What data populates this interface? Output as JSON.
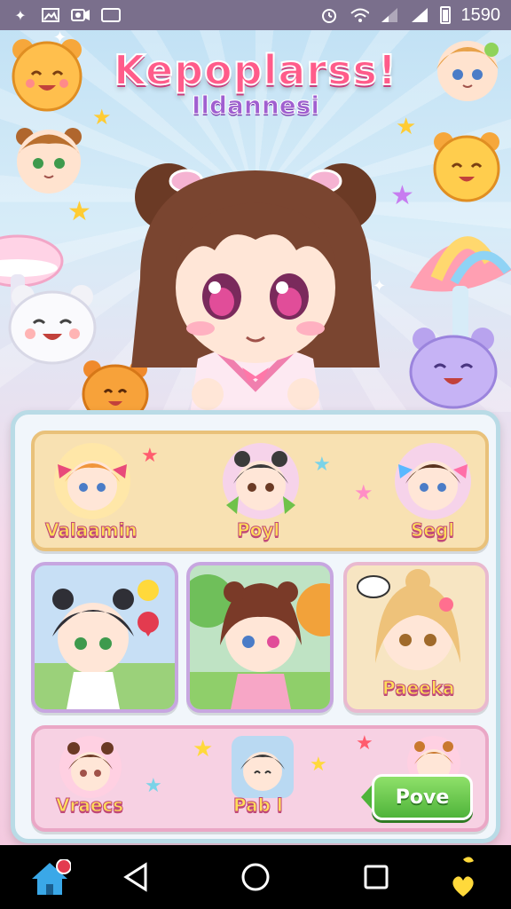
{
  "status_bar": {
    "time": "1590",
    "icons": [
      "pinwheel-icon",
      "image-icon",
      "camera-icon",
      "box-icon",
      "alarm-icon",
      "wifi-icon",
      "signal-icon",
      "signal-icon",
      "battery-icon"
    ]
  },
  "hero": {
    "title": "Kepoplarss!",
    "subtitle": "Ildannesi"
  },
  "panel": {
    "row1": [
      {
        "name": "Valaamin",
        "ribbon": "#ff6f9f"
      },
      {
        "name": "Poyl",
        "ribbon": "#ff6f9f"
      },
      {
        "name": "Segl",
        "ribbon": "#6fc3ff"
      }
    ],
    "row2": [
      {
        "name": ""
      },
      {
        "name": ""
      },
      {
        "name": "Paeeka"
      }
    ],
    "row3": [
      {
        "name": "Vraecs"
      },
      {
        "name": "Pab l"
      }
    ],
    "action_button": "Pove"
  },
  "nav": {
    "items": [
      "home-icon",
      "back-icon",
      "home-circle-icon",
      "recents-icon",
      "assistant-icon"
    ]
  },
  "colors": {
    "accent": "#ff5c8a",
    "button": "#4fb43a",
    "status_bar": "#7a6f8c"
  }
}
